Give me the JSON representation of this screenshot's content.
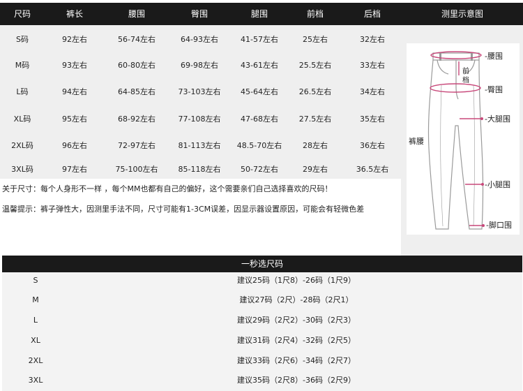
{
  "size_chart": {
    "headers": [
      "尺码",
      "裤长",
      "腰围",
      "臀围",
      "腿围",
      "前档",
      "后档",
      "测里示意图"
    ],
    "rows": [
      [
        "S码",
        "92左右",
        "56-74左右",
        "64-93左右",
        "41-57左右",
        "25左右",
        "32左右"
      ],
      [
        "M码",
        "93左右",
        "60-80左右",
        "69-98左右",
        "43-61左右",
        "25.5左右",
        "33左右"
      ],
      [
        "L码",
        "94左右",
        "64-85左右",
        "73-103左右",
        "45-64左右",
        "26.5左右",
        "34左右"
      ],
      [
        "XL码",
        "95左右",
        "68-92左右",
        "77-108左右",
        "47-68左右",
        "27.5左右",
        "35左右"
      ],
      [
        "2XL码",
        "96左右",
        "72-97左右",
        "81-113左右",
        "48.5-70左右",
        "28左右",
        "36左右"
      ],
      [
        "3XL码",
        "97左右",
        "75-100左右",
        "85-118左右",
        "50-72左右",
        "29左右",
        "36.5左右"
      ]
    ],
    "notes": [
      "关于尺寸：每个人身形不一样 ，每个MM也都有自己的偏好，这个需要亲们自己选择喜欢的尺码！",
      "温馨提示：裤子弹性大，因测里手法不同，尺寸可能有1-3CM误差，因显示器设置原因，可能会有轻微色差"
    ]
  },
  "diagram": {
    "labels": {
      "waist": "-腰围",
      "front_rise": "前\n档",
      "hip": "-臀围",
      "thigh": "-大腿围",
      "pant_waist": "裤腰",
      "calf": "-小腿围",
      "hem": "-脚口围"
    },
    "line_color": "#c8487a",
    "outline_color": "#9a9a9a"
  },
  "recommend": {
    "title": "一秒选尺码",
    "rows": [
      {
        "size": "S",
        "text": "建议25码（1尺8）-26码（1尺9）"
      },
      {
        "size": "M",
        "text": "建议27码（2尺）-28码（2尺1）"
      },
      {
        "size": "L",
        "text": "建议29码（2尺2）-30码（2尺3）"
      },
      {
        "size": "XL",
        "text": "建议31码（2尺4）-32码（2尺5）"
      },
      {
        "size": "2XL",
        "text": "建议33码（2尺6）-34码（2尺7）"
      },
      {
        "size": "3XL",
        "text": "建议35码（2尺8）-36码（2尺9）"
      }
    ]
  }
}
